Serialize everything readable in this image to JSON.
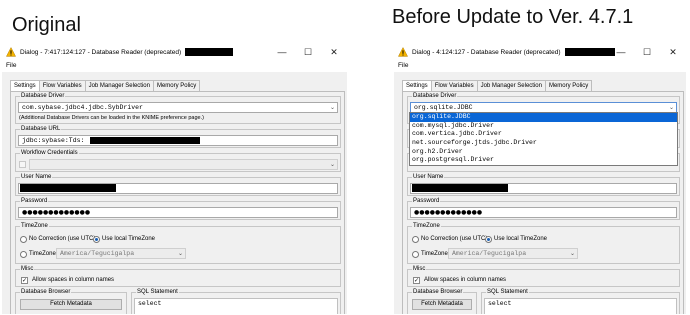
{
  "captions": {
    "left": "Original",
    "right": "Before Update to Ver. 4.7.1"
  },
  "left_window": {
    "title": "Dialog - 7:417:124:127 - Database Reader (deprecated)",
    "menu_file": "File",
    "tabs": [
      "Settings",
      "Flow Variables",
      "Job Manager Selection",
      "Memory Policy"
    ],
    "database_driver": {
      "label": "Database Driver",
      "value": "com.sybase.jdbc4.jdbc.SybDriver",
      "note": "(Additional Database Drivers can be loaded in the KNIME preference page.)"
    },
    "database_url": {
      "label": "Database URL",
      "value": "jdbc:sybase:Tds:"
    },
    "workflow_credentials": {
      "label": "Workflow Credentials"
    },
    "user_name": {
      "label": "User Name"
    },
    "password": {
      "label": "Password",
      "value": "●●●●●●●●●●●●●"
    },
    "timezone": {
      "label": "TimeZone",
      "no_correction": "No Correction (use UTC)",
      "use_local": "Use local TimeZone",
      "timezone_label": "TimeZone:",
      "timezone_value": "America/Tegucigalpa"
    },
    "misc": {
      "label": "Misc",
      "allow_spaces": "Allow spaces in column names"
    },
    "database_browser": {
      "label": "Database Browser",
      "fetch_button": "Fetch Metadata"
    },
    "sql_statement": {
      "label": "SQL Statement",
      "value": "select"
    }
  },
  "right_window": {
    "title": "Dialog - 4:124:127 - Database Reader (deprecated)",
    "menu_file": "File",
    "tabs": [
      "Settings",
      "Flow Variables",
      "Job Manager Selection",
      "Memory Policy"
    ],
    "database_driver": {
      "label": "Database Driver",
      "value": "org.sqlite.JDBC",
      "options": [
        "org.sqlite.JDBC",
        "com.mysql.jdbc.Driver",
        "com.vertica.jdbc.Driver",
        "net.sourceforge.jtds.jdbc.Driver",
        "org.h2.Driver",
        "org.postgresql.Driver"
      ]
    },
    "user_name": {
      "label": "User Name"
    },
    "password": {
      "label": "Password",
      "value": "●●●●●●●●●●●●●"
    },
    "timezone": {
      "label": "TimeZone",
      "no_correction": "No Correction (use UTC)",
      "use_local": "Use local TimeZone",
      "timezone_label": "TimeZone:",
      "timezone_value": "America/Tegucigalpa"
    },
    "misc": {
      "label": "Misc",
      "allow_spaces": "Allow spaces in column names"
    },
    "database_browser": {
      "label": "Database Browser",
      "fetch_button": "Fetch Metadata"
    },
    "sql_statement": {
      "label": "SQL Statement",
      "value": "select"
    }
  },
  "colors": {
    "accent": "#0a66d6",
    "warning": "#f5b400",
    "panel": "#f0f0f0"
  }
}
